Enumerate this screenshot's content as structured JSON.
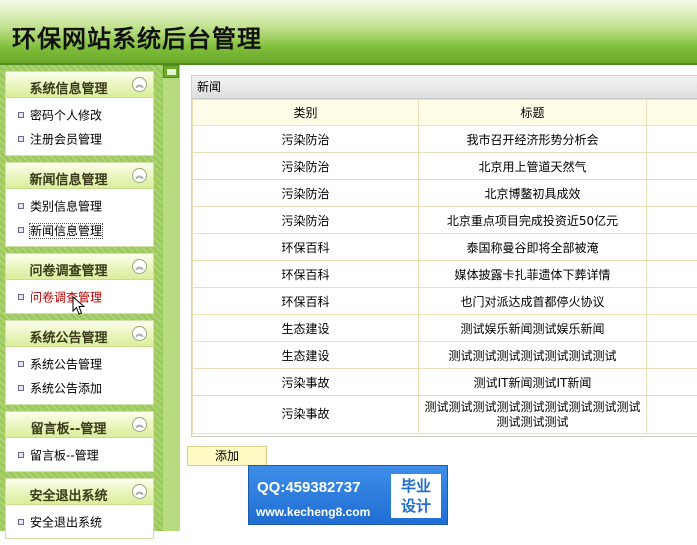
{
  "header": {
    "title": "环保网站系统后台管理"
  },
  "sidebar": {
    "groups": [
      {
        "title": "系统信息管理",
        "items": [
          "密码个人修改",
          "注册会员管理"
        ]
      },
      {
        "title": "新闻信息管理",
        "items": [
          "类别信息管理",
          "新闻信息管理"
        ]
      },
      {
        "title": "问卷调查管理",
        "items": [
          "问卷调查管理"
        ]
      },
      {
        "title": "系统公告管理",
        "items": [
          "系统公告管理",
          "系统公告添加"
        ]
      },
      {
        "title": "留言板--管理",
        "items": [
          "留言板--管理"
        ]
      },
      {
        "title": "安全退出系统",
        "items": [
          "安全退出系统"
        ]
      }
    ],
    "collapse_icon": "double-chevron-up"
  },
  "main": {
    "panel_title": "新闻",
    "columns": [
      "类别",
      "标题"
    ],
    "rows": [
      [
        "污染防治",
        "我市召开经济形势分析会"
      ],
      [
        "污染防治",
        "北京用上管道天然气"
      ],
      [
        "污染防治",
        "北京博鳌初具成效"
      ],
      [
        "污染防治",
        "北京重点项目完成投资近50亿元"
      ],
      [
        "环保百科",
        "泰国称曼谷即将全部被淹"
      ],
      [
        "环保百科",
        "媒体披露卡扎菲遗体下葬详情"
      ],
      [
        "环保百科",
        "也门对派达成首都停火协议"
      ],
      [
        "生态建设",
        "测试娱乐新闻测试娱乐新闻"
      ],
      [
        "生态建设",
        "测试测试测试测试测试测试测试"
      ],
      [
        "污染事故",
        "测试IT新闻测试IT新闻"
      ],
      [
        "污染事故",
        "测试测试测试测试测试测试测试测试测试测试测试测试"
      ]
    ],
    "add_label": "添加"
  },
  "watermark": {
    "qq": "QQ:459382737",
    "url": "www.kecheng8.com",
    "badge_line1": "毕业",
    "badge_line2": "设计"
  },
  "colors": {
    "header_green": "#7fbf3a",
    "sidebar_green": "#9cc95a",
    "active_item": "#c00000"
  }
}
